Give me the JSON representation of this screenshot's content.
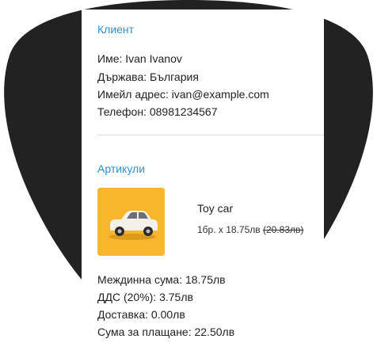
{
  "customer": {
    "section_title": "Клиент",
    "name_line": "Име: Ivan Ivanov",
    "country_line": "Държава: България",
    "email_line": "Имейл адрес: ivan@example.com",
    "phone_line": "Телефон: 08981234567"
  },
  "items": {
    "section_title": "Артикули",
    "list": [
      {
        "name": "Toy car",
        "qty_price": "1бр. x 18.75лв ",
        "old_price": "(20.83лв)",
        "image_icon": "toy-car-icon"
      }
    ]
  },
  "totals": {
    "subtotal_line": "Междинна сума: 18.75лв",
    "vat_line": "ДДС (20%): 3.75лв",
    "shipping_line": "Доставка: 0.00лв",
    "total_line": "Сума за плащане: 22.50лв"
  },
  "colors": {
    "accent": "#2b8fd6",
    "backdrop": "#222222",
    "thumb_bg": "#f7b62c"
  }
}
